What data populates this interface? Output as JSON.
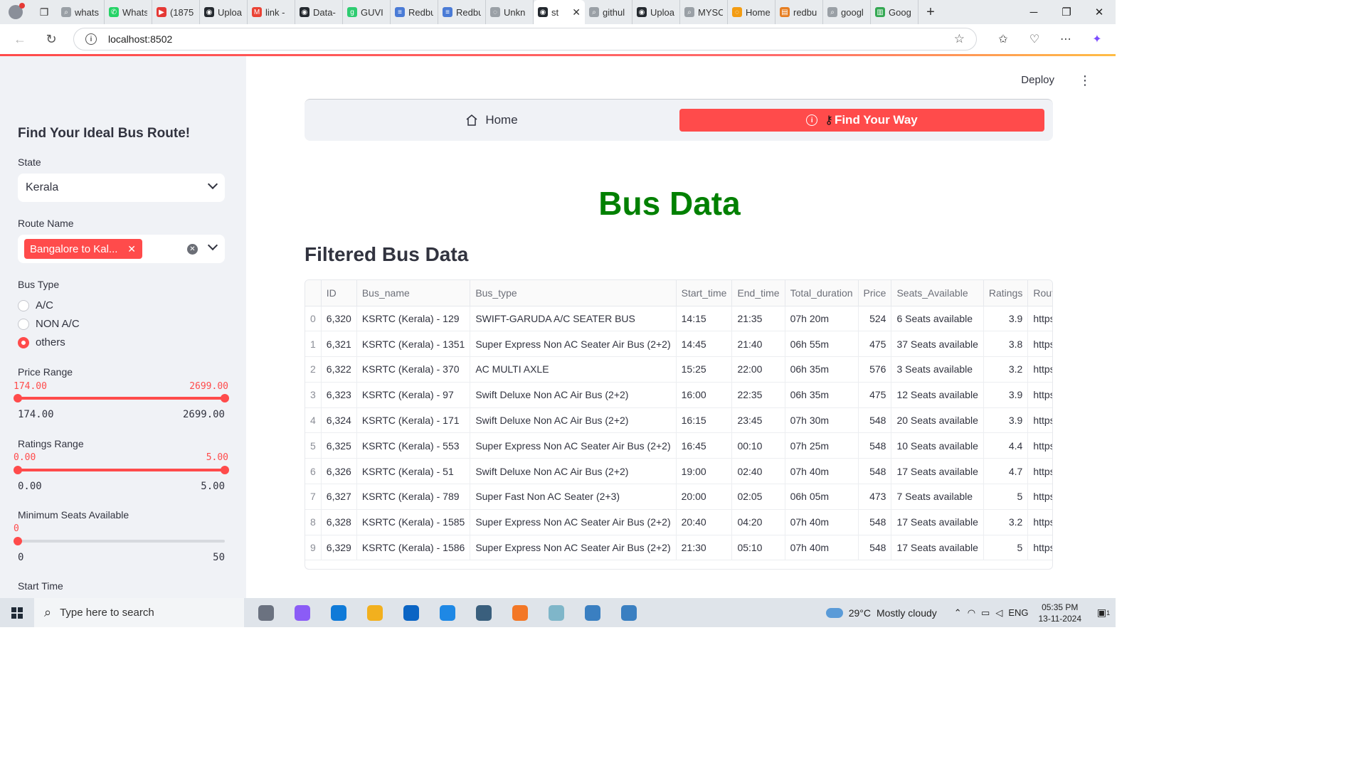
{
  "browser": {
    "tabs": [
      {
        "label": "whats",
        "color": "#9aa0a6",
        "glyph": "⌕"
      },
      {
        "label": "Whats",
        "color": "#25d366",
        "glyph": "✆"
      },
      {
        "label": "(1875",
        "color": "#e53935",
        "glyph": "▶"
      },
      {
        "label": "Uploa",
        "color": "#24292f",
        "glyph": "◉"
      },
      {
        "label": "link -",
        "color": "#ea4335",
        "glyph": "M"
      },
      {
        "label": "Data-",
        "color": "#24292f",
        "glyph": "◉"
      },
      {
        "label": "GUVI",
        "color": "#2ecc71",
        "glyph": "g"
      },
      {
        "label": "Redbu",
        "color": "#4a7bd6",
        "glyph": "≡"
      },
      {
        "label": "Redbu",
        "color": "#4a7bd6",
        "glyph": "≡"
      },
      {
        "label": "Unkn",
        "color": "#9aa0a6",
        "glyph": "◌"
      }
    ],
    "active_tab": {
      "label": "st",
      "color": "#24292f",
      "glyph": "◉"
    },
    "tabs_after": [
      {
        "label": "githul",
        "color": "#9aa0a6",
        "glyph": "⌕"
      },
      {
        "label": "Uploa",
        "color": "#24292f",
        "glyph": "◉"
      },
      {
        "label": "MYSC",
        "color": "#9aa0a6",
        "glyph": "⌕"
      },
      {
        "label": "Home",
        "color": "#f39c12",
        "glyph": "◌"
      },
      {
        "label": "redbu",
        "color": "#e67e22",
        "glyph": "▤"
      },
      {
        "label": "googl",
        "color": "#9aa0a6",
        "glyph": "⌕"
      },
      {
        "label": "Goog",
        "color": "#34a853",
        "glyph": "▥"
      }
    ],
    "url": "localhost:8502"
  },
  "sidebar": {
    "title": "Find Your Ideal Bus Route!",
    "state_label": "State",
    "state_value": "Kerala",
    "route_label": "Route Name",
    "route_chip": "Bangalore to Kal...",
    "bustype_label": "Bus Type",
    "bustype_options": [
      "A/C",
      "NON A/C",
      "others"
    ],
    "bustype_selected": 2,
    "price": {
      "label": "Price Range",
      "min_value": "174.00",
      "max_value": "2699.00",
      "min": "174.00",
      "max": "2699.00",
      "low": 174,
      "high": 2699,
      "lo_bound": 174,
      "hi_bound": 2699
    },
    "ratings": {
      "label": "Ratings Range",
      "min_value": "0.00",
      "max_value": "5.00",
      "min": "0.00",
      "max": "5.00",
      "low": 0,
      "high": 5,
      "lo_bound": 0,
      "hi_bound": 5
    },
    "seats": {
      "label": "Minimum Seats Available",
      "value": "0",
      "min": "0",
      "max": "50",
      "v": 0,
      "lo_bound": 0,
      "hi_bound": 50
    },
    "start_time_label": "Start Time"
  },
  "main": {
    "deploy": "Deploy",
    "nav_home": "Home",
    "nav_find": "Find Your Way",
    "title": "Bus Data",
    "title_color": "#008000",
    "accent": "#ff4b4b",
    "subheading": "Filtered Bus Data"
  },
  "table": {
    "columns": [
      "",
      "ID",
      "Bus_name",
      "Bus_type",
      "Start_time",
      "End_time",
      "Total_duration",
      "Price",
      "Seats_Available",
      "Ratings",
      "Route"
    ],
    "rows": [
      [
        "0",
        "6,320",
        "KSRTC (Kerala) - 129",
        "SWIFT-GARUDA A/C SEATER BUS",
        "14:15",
        "21:35",
        "07h 20m",
        "524",
        "6 Seats available",
        "3.9",
        "https"
      ],
      [
        "1",
        "6,321",
        "KSRTC (Kerala) - 1351",
        "Super Express Non AC Seater Air Bus (2+2)",
        "14:45",
        "21:40",
        "06h 55m",
        "475",
        "37 Seats available",
        "3.8",
        "https"
      ],
      [
        "2",
        "6,322",
        "KSRTC (Kerala) - 370",
        "AC MULTI AXLE",
        "15:25",
        "22:00",
        "06h 35m",
        "576",
        "3 Seats available",
        "3.2",
        "https"
      ],
      [
        "3",
        "6,323",
        "KSRTC (Kerala) - 97",
        "Swift Deluxe Non AC Air Bus (2+2)",
        "16:00",
        "22:35",
        "06h 35m",
        "475",
        "12 Seats available",
        "3.9",
        "https"
      ],
      [
        "4",
        "6,324",
        "KSRTC (Kerala) - 171",
        "Swift Deluxe Non AC Air Bus (2+2)",
        "16:15",
        "23:45",
        "07h 30m",
        "548",
        "20 Seats available",
        "3.9",
        "https"
      ],
      [
        "5",
        "6,325",
        "KSRTC (Kerala) - 553",
        "Super Express Non AC Seater Air Bus (2+2)",
        "16:45",
        "00:10",
        "07h 25m",
        "548",
        "10 Seats available",
        "4.4",
        "https"
      ],
      [
        "6",
        "6,326",
        "KSRTC (Kerala) - 51",
        "Swift Deluxe Non AC Air Bus (2+2)",
        "19:00",
        "02:40",
        "07h 40m",
        "548",
        "17 Seats available",
        "4.7",
        "https"
      ],
      [
        "7",
        "6,327",
        "KSRTC (Kerala) - 789",
        "Super Fast Non AC Seater (2+3)",
        "20:00",
        "02:05",
        "06h 05m",
        "473",
        "7 Seats available",
        "5",
        "https"
      ],
      [
        "8",
        "6,328",
        "KSRTC (Kerala) - 1585",
        "Super Express Non AC Seater Air Bus (2+2)",
        "20:40",
        "04:20",
        "07h 40m",
        "548",
        "17 Seats available",
        "3.2",
        "https"
      ],
      [
        "9",
        "6,329",
        "KSRTC (Kerala) - 1586",
        "Super Express Non AC Seater Air Bus (2+2)",
        "21:30",
        "05:10",
        "07h 40m",
        "548",
        "17 Seats available",
        "5",
        "https"
      ]
    ]
  },
  "taskbar": {
    "search_placeholder": "Type here to search",
    "weather_temp": "29°C",
    "weather_text": "Mostly cloudy",
    "weather_alert": "1",
    "lang": "ENG",
    "time": "05:35 PM",
    "date": "13-11-2024",
    "notif_count": "1",
    "apps": [
      {
        "name": "task-view",
        "color": "#6b7280"
      },
      {
        "name": "copilot",
        "color": "#8b5cf6"
      },
      {
        "name": "edge",
        "color": "#0f7ad8"
      },
      {
        "name": "file-explorer",
        "color": "#f2b01e"
      },
      {
        "name": "outlook",
        "color": "#0a64c4"
      },
      {
        "name": "vscode",
        "color": "#1e88e5"
      },
      {
        "name": "mysql-workbench",
        "color": "#3a5f7d"
      },
      {
        "name": "jupyter",
        "color": "#f37726"
      },
      {
        "name": "app-9",
        "color": "#7fb6c9"
      },
      {
        "name": "python-1",
        "color": "#3a7fc1"
      },
      {
        "name": "python-2",
        "color": "#3a7fc1"
      }
    ]
  }
}
